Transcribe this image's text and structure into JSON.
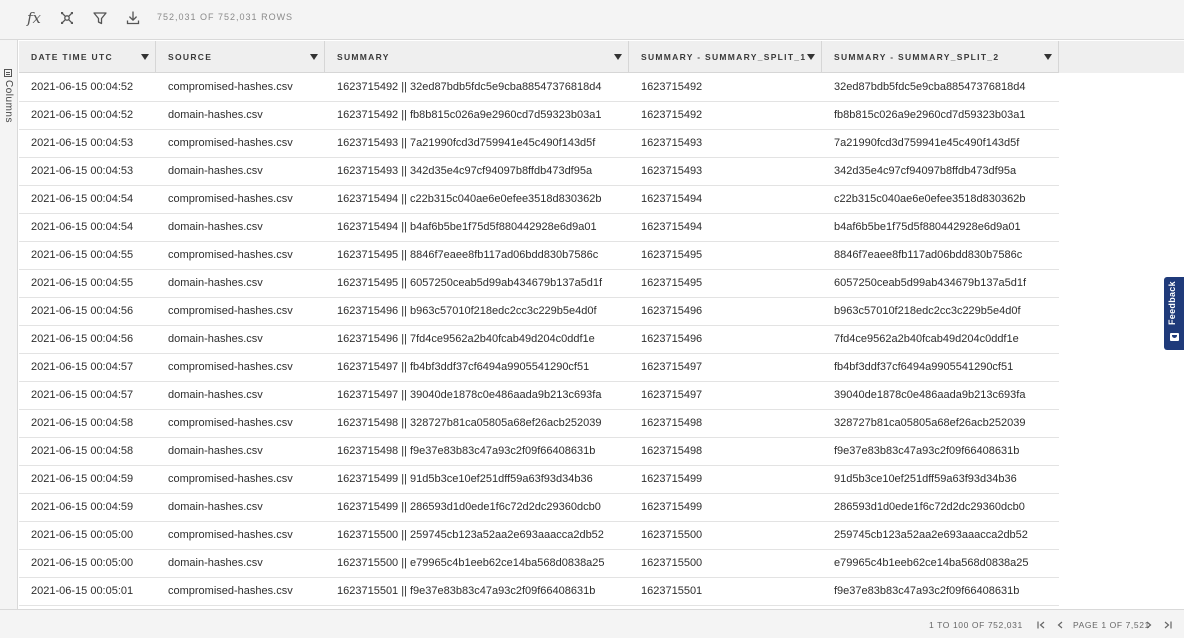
{
  "toolbar": {
    "formula_icon_label": "fx",
    "row_count": "752,031 of 752,031 rows",
    "icons": [
      "formula-icon",
      "transform-icon",
      "filter-icon",
      "download-icon"
    ]
  },
  "side_panel": {
    "tab_label": "Columns"
  },
  "grid": {
    "columns": [
      "Date Time UTC",
      "Source",
      "Summary",
      "Summary - Summary_split_1",
      "Summary - Summary_split_2"
    ],
    "rows": [
      [
        "2021-06-15 00:04:52",
        "compromised-hashes.csv",
        "1623715492 || 32ed87bdb5fdc5e9cba88547376818d4",
        "1623715492",
        "32ed87bdb5fdc5e9cba88547376818d4"
      ],
      [
        "2021-06-15 00:04:52",
        "domain-hashes.csv",
        "1623715492 || fb8b815c026a9e2960cd7d59323b03a1",
        "1623715492",
        "fb8b815c026a9e2960cd7d59323b03a1"
      ],
      [
        "2021-06-15 00:04:53",
        "compromised-hashes.csv",
        "1623715493 || 7a21990fcd3d759941e45c490f143d5f",
        "1623715493",
        "7a21990fcd3d759941e45c490f143d5f"
      ],
      [
        "2021-06-15 00:04:53",
        "domain-hashes.csv",
        "1623715493 || 342d35e4c97cf94097b8ffdb473df95a",
        "1623715493",
        "342d35e4c97cf94097b8ffdb473df95a"
      ],
      [
        "2021-06-15 00:04:54",
        "compromised-hashes.csv",
        "1623715494 || c22b315c040ae6e0efee3518d830362b",
        "1623715494",
        "c22b315c040ae6e0efee3518d830362b"
      ],
      [
        "2021-06-15 00:04:54",
        "domain-hashes.csv",
        "1623715494 || b4af6b5be1f75d5f880442928e6d9a01",
        "1623715494",
        "b4af6b5be1f75d5f880442928e6d9a01"
      ],
      [
        "2021-06-15 00:04:55",
        "compromised-hashes.csv",
        "1623715495 || 8846f7eaee8fb117ad06bdd830b7586c",
        "1623715495",
        "8846f7eaee8fb117ad06bdd830b7586c"
      ],
      [
        "2021-06-15 00:04:55",
        "domain-hashes.csv",
        "1623715495 || 6057250ceab5d99ab434679b137a5d1f",
        "1623715495",
        "6057250ceab5d99ab434679b137a5d1f"
      ],
      [
        "2021-06-15 00:04:56",
        "compromised-hashes.csv",
        "1623715496 || b963c57010f218edc2cc3c229b5e4d0f",
        "1623715496",
        "b963c57010f218edc2cc3c229b5e4d0f"
      ],
      [
        "2021-06-15 00:04:56",
        "domain-hashes.csv",
        "1623715496 || 7fd4ce9562a2b40fcab49d204c0ddf1e",
        "1623715496",
        "7fd4ce9562a2b40fcab49d204c0ddf1e"
      ],
      [
        "2021-06-15 00:04:57",
        "compromised-hashes.csv",
        "1623715497 || fb4bf3ddf37cf6494a9905541290cf51",
        "1623715497",
        "fb4bf3ddf37cf6494a9905541290cf51"
      ],
      [
        "2021-06-15 00:04:57",
        "domain-hashes.csv",
        "1623715497 || 39040de1878c0e486aada9b213c693fa",
        "1623715497",
        "39040de1878c0e486aada9b213c693fa"
      ],
      [
        "2021-06-15 00:04:58",
        "compromised-hashes.csv",
        "1623715498 || 328727b81ca05805a68ef26acb252039",
        "1623715498",
        "328727b81ca05805a68ef26acb252039"
      ],
      [
        "2021-06-15 00:04:58",
        "domain-hashes.csv",
        "1623715498 || f9e37e83b83c47a93c2f09f66408631b",
        "1623715498",
        "f9e37e83b83c47a93c2f09f66408631b"
      ],
      [
        "2021-06-15 00:04:59",
        "compromised-hashes.csv",
        "1623715499 || 91d5b3ce10ef251dff59a63f93d34b36",
        "1623715499",
        "91d5b3ce10ef251dff59a63f93d34b36"
      ],
      [
        "2021-06-15 00:04:59",
        "domain-hashes.csv",
        "1623715499 || 286593d1d0ede1f6c72d2dc29360dcb0",
        "1623715499",
        "286593d1d0ede1f6c72d2dc29360dcb0"
      ],
      [
        "2021-06-15 00:05:00",
        "compromised-hashes.csv",
        "1623715500 || 259745cb123a52aa2e693aaacca2db52",
        "1623715500",
        "259745cb123a52aa2e693aaacca2db52"
      ],
      [
        "2021-06-15 00:05:00",
        "domain-hashes.csv",
        "1623715500 || e79965c4b1eeb62ce14ba568d0838a25",
        "1623715500",
        "e79965c4b1eeb62ce14ba568d0838a25"
      ],
      [
        "2021-06-15 00:05:01",
        "compromised-hashes.csv",
        "1623715501 || f9e37e83b83c47a93c2f09f66408631b",
        "1623715501",
        "f9e37e83b83c47a93c2f09f66408631b"
      ]
    ]
  },
  "pagination": {
    "summary": "1 to 100 of 752,031",
    "page_description": "Page 1 of 7,521"
  },
  "feedback": {
    "label": "Feedback"
  },
  "colors": {
    "feedback_tab": "#1f3a7a",
    "header_background": "#efefef",
    "toolbar_background": "#f4f4f4"
  }
}
